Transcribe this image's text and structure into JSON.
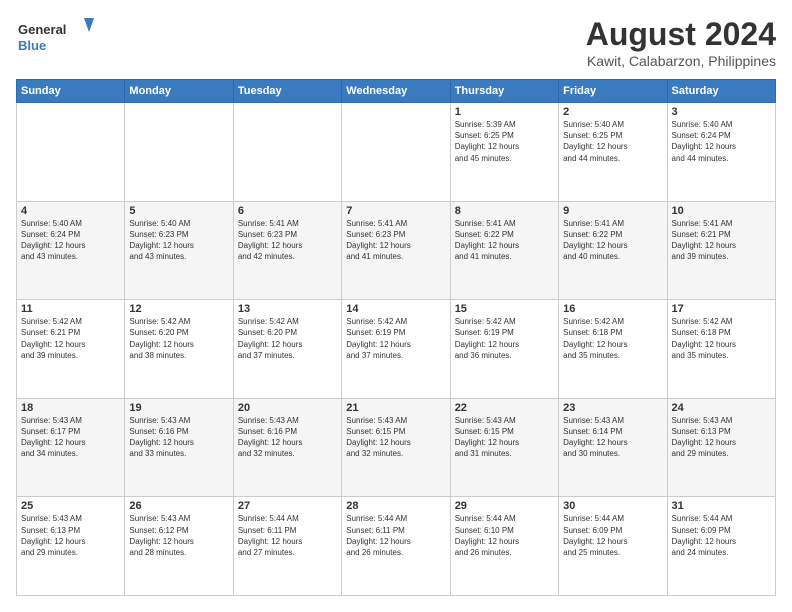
{
  "header": {
    "logo_line1": "General",
    "logo_line2": "Blue",
    "title": "August 2024",
    "subtitle": "Kawit, Calabarzon, Philippines"
  },
  "weekdays": [
    "Sunday",
    "Monday",
    "Tuesday",
    "Wednesday",
    "Thursday",
    "Friday",
    "Saturday"
  ],
  "weeks": [
    [
      {
        "day": "",
        "info": ""
      },
      {
        "day": "",
        "info": ""
      },
      {
        "day": "",
        "info": ""
      },
      {
        "day": "",
        "info": ""
      },
      {
        "day": "1",
        "info": "Sunrise: 5:39 AM\nSunset: 6:25 PM\nDaylight: 12 hours\nand 45 minutes."
      },
      {
        "day": "2",
        "info": "Sunrise: 5:40 AM\nSunset: 6:25 PM\nDaylight: 12 hours\nand 44 minutes."
      },
      {
        "day": "3",
        "info": "Sunrise: 5:40 AM\nSunset: 6:24 PM\nDaylight: 12 hours\nand 44 minutes."
      }
    ],
    [
      {
        "day": "4",
        "info": "Sunrise: 5:40 AM\nSunset: 6:24 PM\nDaylight: 12 hours\nand 43 minutes."
      },
      {
        "day": "5",
        "info": "Sunrise: 5:40 AM\nSunset: 6:23 PM\nDaylight: 12 hours\nand 43 minutes."
      },
      {
        "day": "6",
        "info": "Sunrise: 5:41 AM\nSunset: 6:23 PM\nDaylight: 12 hours\nand 42 minutes."
      },
      {
        "day": "7",
        "info": "Sunrise: 5:41 AM\nSunset: 6:23 PM\nDaylight: 12 hours\nand 41 minutes."
      },
      {
        "day": "8",
        "info": "Sunrise: 5:41 AM\nSunset: 6:22 PM\nDaylight: 12 hours\nand 41 minutes."
      },
      {
        "day": "9",
        "info": "Sunrise: 5:41 AM\nSunset: 6:22 PM\nDaylight: 12 hours\nand 40 minutes."
      },
      {
        "day": "10",
        "info": "Sunrise: 5:41 AM\nSunset: 6:21 PM\nDaylight: 12 hours\nand 39 minutes."
      }
    ],
    [
      {
        "day": "11",
        "info": "Sunrise: 5:42 AM\nSunset: 6:21 PM\nDaylight: 12 hours\nand 39 minutes."
      },
      {
        "day": "12",
        "info": "Sunrise: 5:42 AM\nSunset: 6:20 PM\nDaylight: 12 hours\nand 38 minutes."
      },
      {
        "day": "13",
        "info": "Sunrise: 5:42 AM\nSunset: 6:20 PM\nDaylight: 12 hours\nand 37 minutes."
      },
      {
        "day": "14",
        "info": "Sunrise: 5:42 AM\nSunset: 6:19 PM\nDaylight: 12 hours\nand 37 minutes."
      },
      {
        "day": "15",
        "info": "Sunrise: 5:42 AM\nSunset: 6:19 PM\nDaylight: 12 hours\nand 36 minutes."
      },
      {
        "day": "16",
        "info": "Sunrise: 5:42 AM\nSunset: 6:18 PM\nDaylight: 12 hours\nand 35 minutes."
      },
      {
        "day": "17",
        "info": "Sunrise: 5:42 AM\nSunset: 6:18 PM\nDaylight: 12 hours\nand 35 minutes."
      }
    ],
    [
      {
        "day": "18",
        "info": "Sunrise: 5:43 AM\nSunset: 6:17 PM\nDaylight: 12 hours\nand 34 minutes."
      },
      {
        "day": "19",
        "info": "Sunrise: 5:43 AM\nSunset: 6:16 PM\nDaylight: 12 hours\nand 33 minutes."
      },
      {
        "day": "20",
        "info": "Sunrise: 5:43 AM\nSunset: 6:16 PM\nDaylight: 12 hours\nand 32 minutes."
      },
      {
        "day": "21",
        "info": "Sunrise: 5:43 AM\nSunset: 6:15 PM\nDaylight: 12 hours\nand 32 minutes."
      },
      {
        "day": "22",
        "info": "Sunrise: 5:43 AM\nSunset: 6:15 PM\nDaylight: 12 hours\nand 31 minutes."
      },
      {
        "day": "23",
        "info": "Sunrise: 5:43 AM\nSunset: 6:14 PM\nDaylight: 12 hours\nand 30 minutes."
      },
      {
        "day": "24",
        "info": "Sunrise: 5:43 AM\nSunset: 6:13 PM\nDaylight: 12 hours\nand 29 minutes."
      }
    ],
    [
      {
        "day": "25",
        "info": "Sunrise: 5:43 AM\nSunset: 6:13 PM\nDaylight: 12 hours\nand 29 minutes."
      },
      {
        "day": "26",
        "info": "Sunrise: 5:43 AM\nSunset: 6:12 PM\nDaylight: 12 hours\nand 28 minutes."
      },
      {
        "day": "27",
        "info": "Sunrise: 5:44 AM\nSunset: 6:11 PM\nDaylight: 12 hours\nand 27 minutes."
      },
      {
        "day": "28",
        "info": "Sunrise: 5:44 AM\nSunset: 6:11 PM\nDaylight: 12 hours\nand 26 minutes."
      },
      {
        "day": "29",
        "info": "Sunrise: 5:44 AM\nSunset: 6:10 PM\nDaylight: 12 hours\nand 26 minutes."
      },
      {
        "day": "30",
        "info": "Sunrise: 5:44 AM\nSunset: 6:09 PM\nDaylight: 12 hours\nand 25 minutes."
      },
      {
        "day": "31",
        "info": "Sunrise: 5:44 AM\nSunset: 6:09 PM\nDaylight: 12 hours\nand 24 minutes."
      }
    ]
  ]
}
